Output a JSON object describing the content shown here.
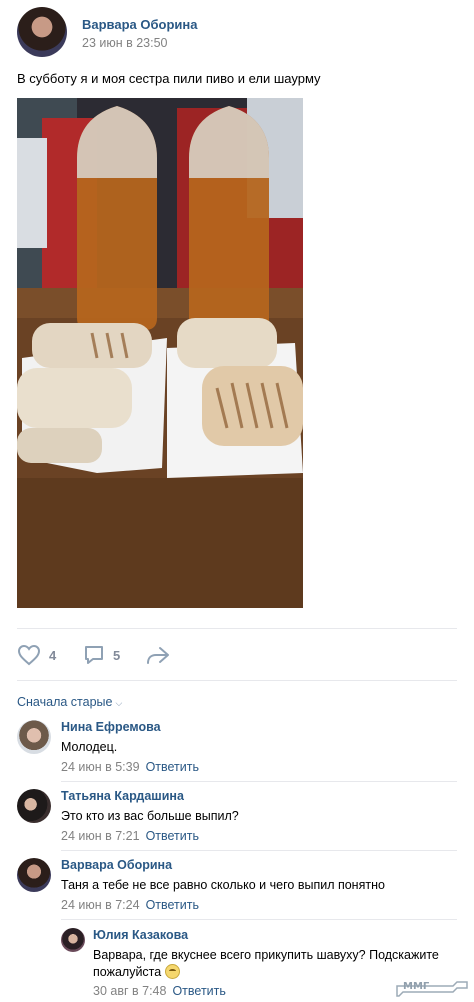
{
  "post": {
    "author": "Варвара Оборина",
    "date": "23 июн в 23:50",
    "text": "В субботу я и моя сестра пили пиво и ели шаурму",
    "photo_alt": "Photo: two plastic bottles of beer and shawarma on a wooden table"
  },
  "actions": {
    "likes": "4",
    "comments": "5",
    "like_icon": "heart-icon",
    "comment_icon": "comment-bubble-icon",
    "share_icon": "share-arrow-icon"
  },
  "comments_sort": "Сначала старые",
  "comments": [
    {
      "author": "Нина Ефремова",
      "text": "Молодец.",
      "date": "24 июн в 5:39",
      "reply": "Ответить"
    },
    {
      "author": "Татьяна Кардашина",
      "text": "Это кто из вас больше выпил?",
      "date": "24 июн в 7:21",
      "reply": "Ответить"
    },
    {
      "author": "Варвара Оборина",
      "text": "Таня а тебе не все равно сколько и чего выпил понятно",
      "date": "24 июн в 7:24",
      "reply": "Ответить"
    },
    {
      "author": "Юлия Казакова",
      "text": "Варвара, где вкуснее всего прикупить шавуху? Подскажите пожалуйста",
      "date": "30 авг в 7:48",
      "reply": "Ответить"
    }
  ],
  "watermark": "ММГ",
  "colors": {
    "link": "#2a5885",
    "meta": "#828282",
    "icon": "#8fa1b4"
  }
}
